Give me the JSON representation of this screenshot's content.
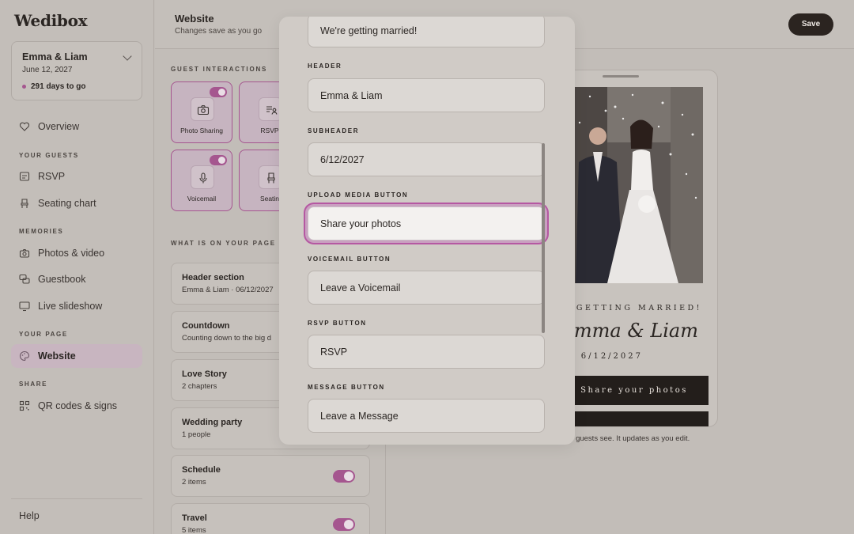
{
  "app": {
    "logo": "Wedibox"
  },
  "couple": {
    "name": "Emma & Liam",
    "date": "June 12, 2027",
    "countdown": "291 days to go"
  },
  "sidebar": {
    "overview": "Overview",
    "your_guests": "YOUR GUESTS",
    "rsvp": "RSVP",
    "seating_chart": "Seating chart",
    "memories": "MEMORIES",
    "photos_video": "Photos & video",
    "guestbook": "Guestbook",
    "live_slideshow": "Live slideshow",
    "your_page": "YOUR PAGE",
    "website": "Website",
    "share": "SHARE",
    "qr_codes": "QR codes & signs",
    "help": "Help"
  },
  "header": {
    "title": "Website",
    "subtitle": "Changes save as you go",
    "save_label": "Save"
  },
  "guest_interactions": {
    "label": "GUEST INTERACTIONS",
    "tiles": [
      {
        "label": "Photo Sharing",
        "icon": "camera-icon",
        "enabled": true
      },
      {
        "label": "RSVP",
        "icon": "rsvp-icon",
        "enabled": true
      },
      {
        "label": "Voicemail",
        "icon": "microphone-icon",
        "enabled": true
      },
      {
        "label": "Seatin",
        "icon": "chair-icon",
        "enabled": true
      }
    ]
  },
  "page_sections": {
    "label": "WHAT IS ON YOUR PAGE",
    "items": [
      {
        "title": "Header section",
        "sub": "Emma & Liam · 06/12/2027",
        "enabled": true
      },
      {
        "title": "Countdown",
        "sub": "Counting down to the big d",
        "enabled": true
      },
      {
        "title": "Love Story",
        "sub": "2 chapters",
        "enabled": true
      },
      {
        "title": "Wedding party",
        "sub": "1 people",
        "enabled": true
      },
      {
        "title": "Schedule",
        "sub": "2 items",
        "enabled": true
      },
      {
        "title": "Travel",
        "sub": "5 items",
        "enabled": true
      }
    ]
  },
  "modal": {
    "first_value": "We're getting married!",
    "header_label": "HEADER",
    "header_value": "Emma & Liam",
    "subheader_label": "SUBHEADER",
    "subheader_value": "6/12/2027",
    "upload_label": "UPLOAD MEDIA BUTTON",
    "upload_value": "Share your photos",
    "voicemail_label": "VOICEMAIL BUTTON",
    "voicemail_value": "Leave a Voicemail",
    "rsvp_label": "RSVP BUTTON",
    "rsvp_value": "RSVP",
    "message_label": "MESSAGE BUTTON",
    "message_value": "Leave a Message"
  },
  "preview": {
    "kicker": "E GETTING MARRIED!",
    "names": "mma & Liam",
    "date": "6/12/2027",
    "button": "Share your photos",
    "caption": "ur guests see. It updates as you edit."
  },
  "colors": {
    "accent": "#a5568f",
    "focus_ring": "#b558a2",
    "dark_button": "#2b2420"
  }
}
